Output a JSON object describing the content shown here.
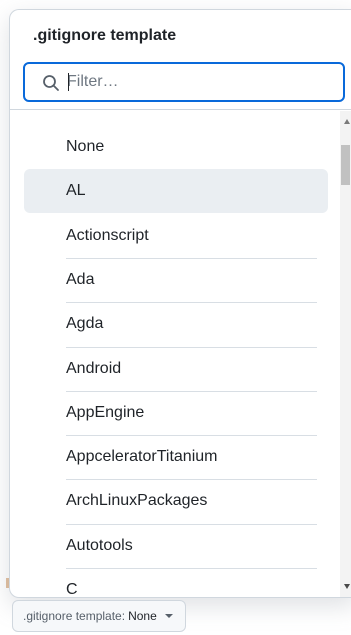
{
  "dropdown": {
    "title": ".gitignore template",
    "filter": {
      "placeholder": "Filter…",
      "value": ""
    },
    "items": [
      {
        "label": "None"
      },
      {
        "label": "AL",
        "highlighted": true
      },
      {
        "label": "Actionscript"
      },
      {
        "label": "Ada"
      },
      {
        "label": "Agda"
      },
      {
        "label": "Android"
      },
      {
        "label": "AppEngine"
      },
      {
        "label": "AppceleratorTitanium"
      },
      {
        "label": "ArchLinuxPackages"
      },
      {
        "label": "Autotools"
      },
      {
        "label": "C"
      }
    ]
  },
  "summary": {
    "prefix": ".gitignore template:",
    "value": "None"
  },
  "colors": {
    "focus_border": "#0969da",
    "highlight_bg": "#eaeef2",
    "divider": "#d8dee4"
  }
}
